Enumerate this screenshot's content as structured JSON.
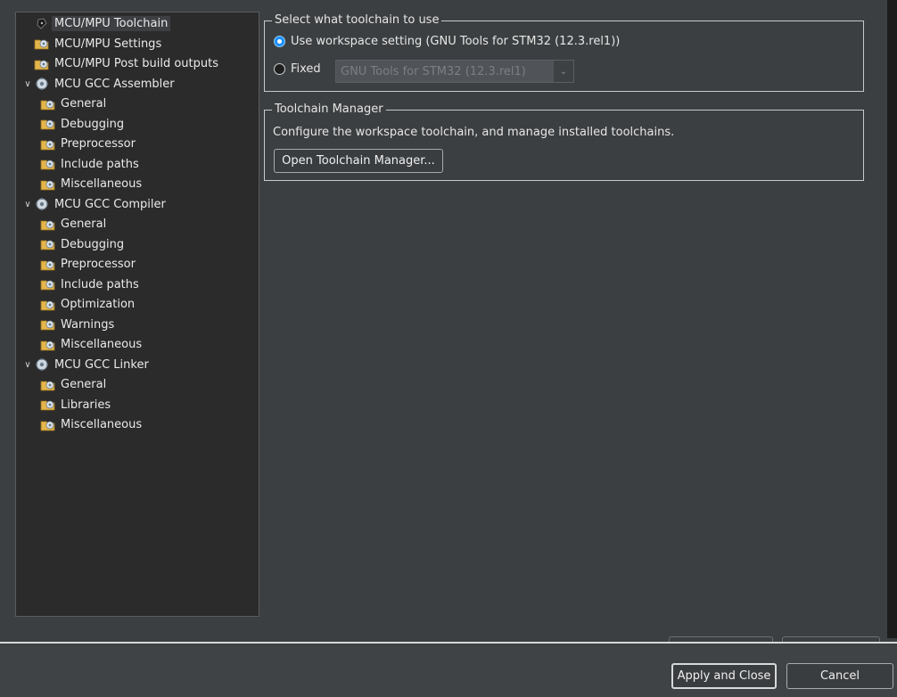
{
  "tree": {
    "items": [
      {
        "label": "MCU/MPU Toolchain",
        "level": 0,
        "icon": "chip-icon",
        "selected": true
      },
      {
        "label": "MCU/MPU Settings",
        "level": 0,
        "icon": "folder-gear-icon"
      },
      {
        "label": "MCU/MPU Post build outputs",
        "level": 0,
        "icon": "folder-gear-icon"
      },
      {
        "label": "MCU GCC Assembler",
        "level": 0,
        "icon": "gear-icon",
        "expanded": true
      },
      {
        "label": "General",
        "level": 1,
        "icon": "folder-gear-icon"
      },
      {
        "label": "Debugging",
        "level": 1,
        "icon": "folder-gear-icon"
      },
      {
        "label": "Preprocessor",
        "level": 1,
        "icon": "folder-gear-icon"
      },
      {
        "label": "Include paths",
        "level": 1,
        "icon": "folder-gear-icon"
      },
      {
        "label": "Miscellaneous",
        "level": 1,
        "icon": "folder-gear-icon"
      },
      {
        "label": "MCU GCC Compiler",
        "level": 0,
        "icon": "gear-icon",
        "expanded": true
      },
      {
        "label": "General",
        "level": 1,
        "icon": "folder-gear-icon"
      },
      {
        "label": "Debugging",
        "level": 1,
        "icon": "folder-gear-icon"
      },
      {
        "label": "Preprocessor",
        "level": 1,
        "icon": "folder-gear-icon"
      },
      {
        "label": "Include paths",
        "level": 1,
        "icon": "folder-gear-icon"
      },
      {
        "label": "Optimization",
        "level": 1,
        "icon": "folder-gear-icon"
      },
      {
        "label": "Warnings",
        "level": 1,
        "icon": "folder-gear-icon"
      },
      {
        "label": "Miscellaneous",
        "level": 1,
        "icon": "folder-gear-icon"
      },
      {
        "label": "MCU GCC Linker",
        "level": 0,
        "icon": "gear-icon",
        "expanded": true
      },
      {
        "label": "General",
        "level": 1,
        "icon": "folder-gear-icon"
      },
      {
        "label": "Libraries",
        "level": 1,
        "icon": "folder-gear-icon"
      },
      {
        "label": "Miscellaneous",
        "level": 1,
        "icon": "folder-gear-icon"
      }
    ]
  },
  "toolchain_group": {
    "legend": "Select what toolchain to use",
    "option_workspace": "Use workspace setting (GNU Tools for STM32 (12.3.rel1))",
    "option_fixed": "Fixed",
    "fixed_combo_value": "GNU Tools for STM32 (12.3.rel1)",
    "selected": "workspace"
  },
  "manager_group": {
    "legend": "Toolchain Manager",
    "description": "Configure the workspace toolchain, and manage installed toolchains.",
    "open_button": "Open Toolchain Manager..."
  },
  "footer": {
    "apply_close": "Apply and Close",
    "cancel": "Cancel"
  },
  "colors": {
    "background": "#3c3f41",
    "tree_background": "#2b2b2b",
    "radio_accent": "#1e90ff"
  }
}
